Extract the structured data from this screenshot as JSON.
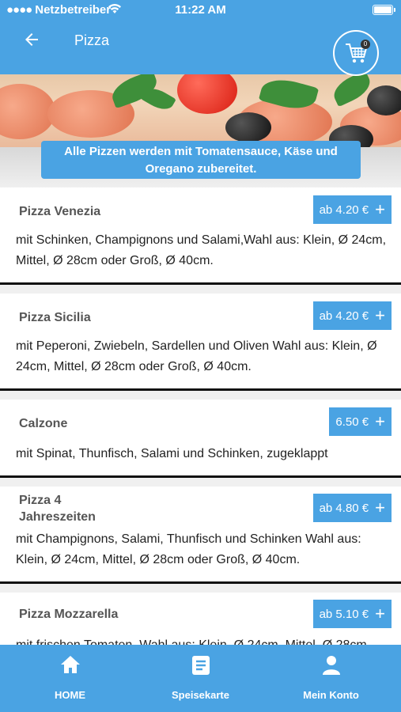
{
  "status_bar": {
    "carrier": "Netzbetreiber",
    "time": "11:22 AM"
  },
  "header": {
    "title": "Pizza",
    "cart_count": "0"
  },
  "notice": "Alle Pizzen werden mit Tomatensauce, Käse und Oregano zubereitet.",
  "items": [
    {
      "name": "Pizza Venezia",
      "price": "ab 4.20 €",
      "description": "mit Schinken, Champignons und Salami,Wahl aus: Klein, Ø 24cm, Mittel, Ø 28cm oder Groß, Ø 40cm."
    },
    {
      "name": "Pizza Sicilia",
      "price": "ab 4.20 €",
      "description": "mit Peperoni, Zwiebeln, Sardellen und Oliven Wahl aus: Klein, Ø 24cm, Mittel, Ø 28cm oder Groß, Ø 40cm."
    },
    {
      "name": "Calzone",
      "price": "6.50 €",
      "description": "mit Spinat, Thunfisch, Salami und Schinken, zugeklappt"
    },
    {
      "name": "Pizza 4 Jahreszeiten",
      "price": "ab 4.80 €",
      "description": "mit Champignons, Salami, Thunfisch und Schinken Wahl aus: Klein, Ø 24cm, Mittel, Ø 28cm oder Groß, Ø 40cm."
    },
    {
      "name": "Pizza Mozzarella",
      "price": "ab 5.10 €",
      "description": "mit frischen Tomaten, Wahl aus: Klein, Ø 24cm, Mittel, Ø 28cm"
    }
  ],
  "tabbar": {
    "home": "HOME",
    "menu": "Speisekarte",
    "account": "Mein Konto"
  },
  "colors": {
    "accent": "#4aa3e3",
    "card_border": "#111111"
  }
}
